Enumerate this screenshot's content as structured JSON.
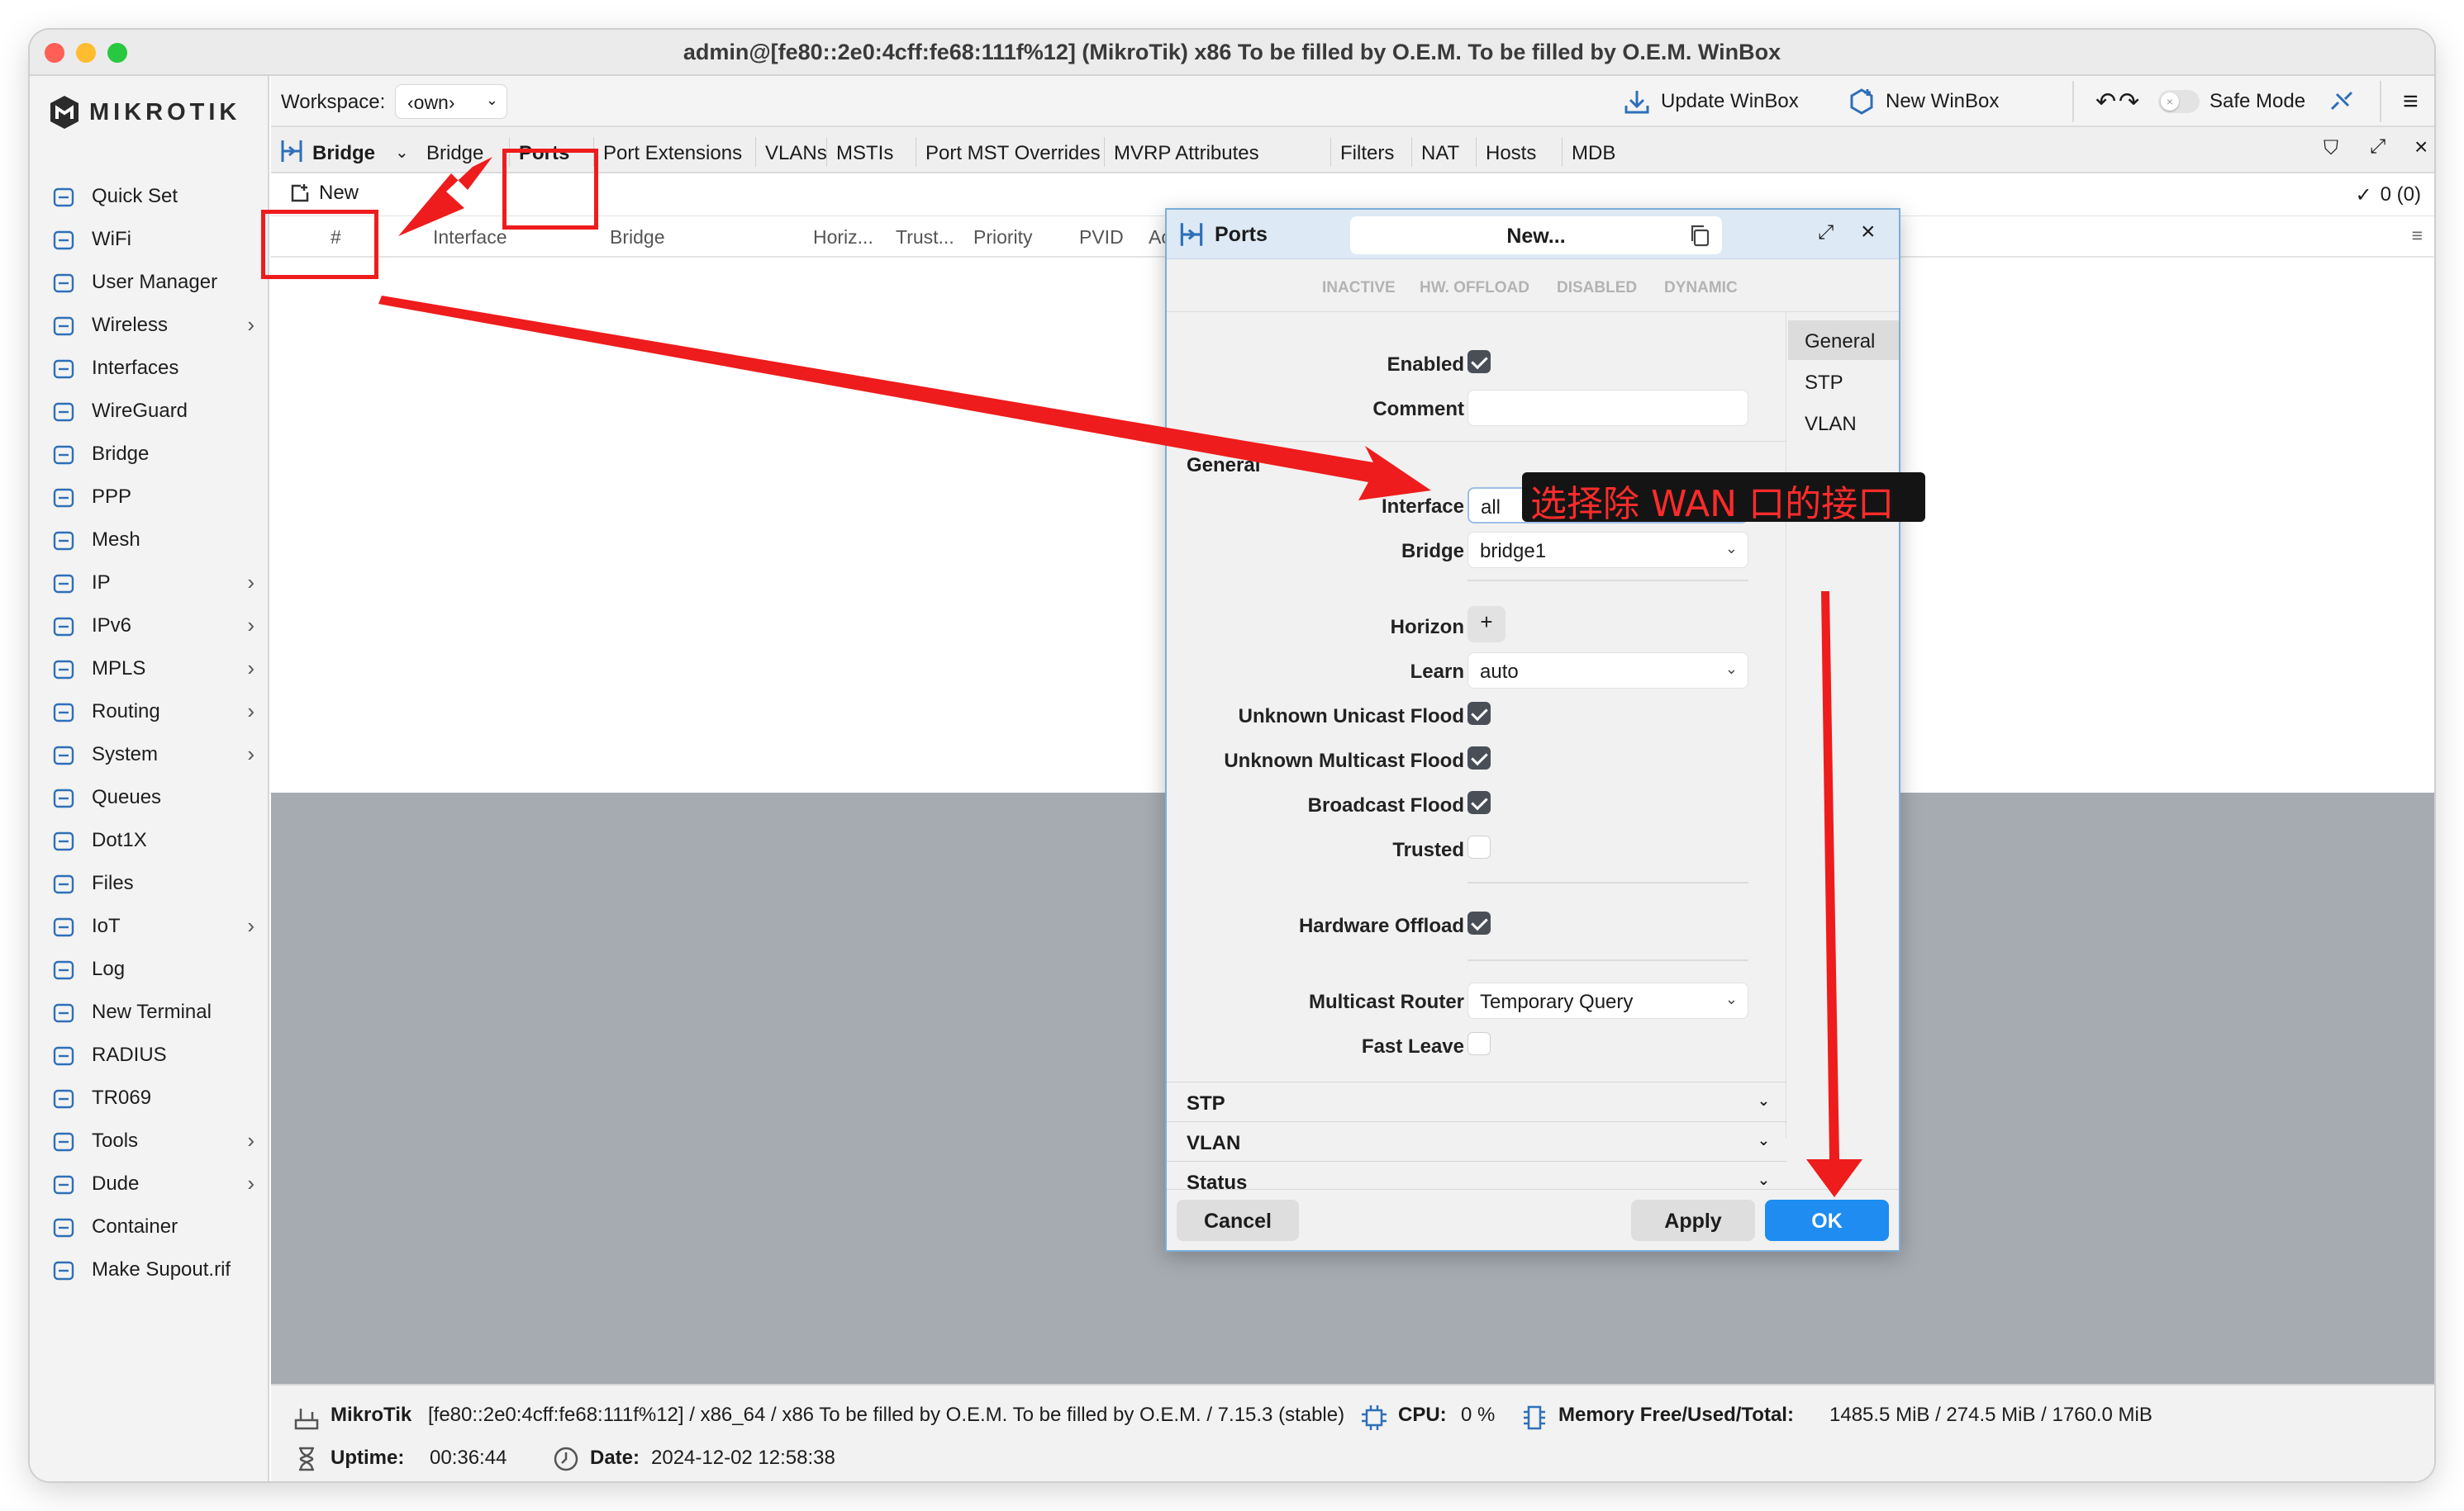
{
  "window": {
    "title": "admin@[fe80::2e0:4cff:fe68:111f%12] (MikroTik) x86 To be filled by O.E.M. To be filled by O.E.M. WinBox"
  },
  "logo": {
    "text": "MIKROTIK"
  },
  "sidebar": {
    "items": [
      {
        "label": "Quick Set",
        "icon": "quick-set-icon",
        "chevron": ""
      },
      {
        "label": "WiFi",
        "icon": "wifi-icon",
        "chevron": ""
      },
      {
        "label": "User Manager",
        "icon": "users-icon",
        "chevron": ""
      },
      {
        "label": "Wireless",
        "icon": "wireless-icon",
        "chevron": "›"
      },
      {
        "label": "Interfaces",
        "icon": "interfaces-icon",
        "chevron": ""
      },
      {
        "label": "WireGuard",
        "icon": "wireguard-icon",
        "chevron": ""
      },
      {
        "label": "Bridge",
        "icon": "bridge-icon",
        "chevron": ""
      },
      {
        "label": "PPP",
        "icon": "ppp-icon",
        "chevron": ""
      },
      {
        "label": "Mesh",
        "icon": "mesh-icon",
        "chevron": ""
      },
      {
        "label": "IP",
        "icon": "ip-icon",
        "chevron": "›"
      },
      {
        "label": "IPv6",
        "icon": "ipv6-icon",
        "chevron": "›"
      },
      {
        "label": "MPLS",
        "icon": "mpls-icon",
        "chevron": "›"
      },
      {
        "label": "Routing",
        "icon": "routing-icon",
        "chevron": "›"
      },
      {
        "label": "System",
        "icon": "gear-icon",
        "chevron": "›"
      },
      {
        "label": "Queues",
        "icon": "queues-icon",
        "chevron": ""
      },
      {
        "label": "Dot1X",
        "icon": "dot1x-icon",
        "chevron": ""
      },
      {
        "label": "Files",
        "icon": "folder-icon",
        "chevron": ""
      },
      {
        "label": "IoT",
        "icon": "iot-icon",
        "chevron": "›"
      },
      {
        "label": "Log",
        "icon": "log-icon",
        "chevron": ""
      },
      {
        "label": "New Terminal",
        "icon": "terminal-icon",
        "chevron": ""
      },
      {
        "label": "RADIUS",
        "icon": "radius-icon",
        "chevron": ""
      },
      {
        "label": "TR069",
        "icon": "tr069-icon",
        "chevron": ""
      },
      {
        "label": "Tools",
        "icon": "tools-icon",
        "chevron": "›"
      },
      {
        "label": "Dude",
        "icon": "dude-icon",
        "chevron": "›"
      },
      {
        "label": "Container",
        "icon": "container-icon",
        "chevron": ""
      },
      {
        "label": "Make Supout.rif",
        "icon": "supout-icon",
        "chevron": ""
      }
    ]
  },
  "topbar": {
    "workspace_label": "Workspace:",
    "workspace_value": "‹own›",
    "update_label": "Update WinBox",
    "new_winbox_label": "New WinBox",
    "safe_mode_label": "Safe Mode",
    "safe_mode_on": false
  },
  "bridge_window": {
    "title": "Bridge",
    "tabs": [
      "Bridge",
      "Ports",
      "Port Extensions",
      "VLANs",
      "MSTIs",
      "Port MST Overrides",
      "MVRP Attributes",
      "Filters",
      "NAT",
      "Hosts",
      "MDB"
    ],
    "active_tab": "Ports",
    "new_label": "New",
    "count": "0 (0)",
    "columns": [
      "#",
      "Interface",
      "Bridge",
      "Horiz...",
      "Trust...",
      "Priority",
      "PVID",
      "Actua"
    ]
  },
  "dialog": {
    "title": "Ports",
    "name": "New...",
    "flags": [
      "INACTIVE",
      "HW. OFFLOAD",
      "DISABLED",
      "DYNAMIC"
    ],
    "section_general": "General",
    "fields": {
      "enabled": {
        "label": "Enabled",
        "checked": true
      },
      "comment": {
        "label": "Comment",
        "value": ""
      },
      "interface": {
        "label": "Interface",
        "value": "all"
      },
      "bridge": {
        "label": "Bridge",
        "value": "bridge1"
      },
      "horizon": {
        "label": "Horizon",
        "button": "+"
      },
      "learn": {
        "label": "Learn",
        "value": "auto"
      },
      "unknown_unicast_flood": {
        "label": "Unknown Unicast Flood",
        "checked": true
      },
      "unknown_multicast_flood": {
        "label": "Unknown Multicast Flood",
        "checked": true
      },
      "broadcast_flood": {
        "label": "Broadcast Flood",
        "checked": true
      },
      "trusted": {
        "label": "Trusted",
        "checked": false
      },
      "hardware_offload": {
        "label": "Hardware Offload",
        "checked": true
      },
      "multicast_router": {
        "label": "Multicast Router",
        "value": "Temporary Query"
      },
      "fast_leave": {
        "label": "Fast Leave",
        "checked": false
      }
    },
    "sections": [
      "STP",
      "VLAN",
      "Status"
    ],
    "side_tabs": [
      "General",
      "STP",
      "VLAN"
    ],
    "buttons": {
      "cancel": "Cancel",
      "apply": "Apply",
      "ok": "OK"
    }
  },
  "annotation": {
    "text": "选择除 WAN 口的接口",
    "color": "#ee1c1c"
  },
  "statusbar": {
    "brand": "MikroTik",
    "identity": "[fe80::2e0:4cff:fe68:111f%12] / x86_64 / x86 To be filled by O.E.M. To be filled by O.E.M. / 7.15.3 (stable)",
    "cpu_label": "CPU:",
    "cpu_value": "0 %",
    "memory_label": "Memory Free/Used/Total:",
    "memory_value": "1485.5 MiB / 274.5 MiB / 1760.0 MiB",
    "uptime_label": "Uptime:",
    "uptime_value": "00:36:44",
    "date_label": "Date:",
    "date_value": "2024-12-02 12:58:38"
  },
  "colors": {
    "accent": "#1e8cf0",
    "annotation_red": "#ee1c1c",
    "sidebar_icon": "#2e6fb8"
  }
}
